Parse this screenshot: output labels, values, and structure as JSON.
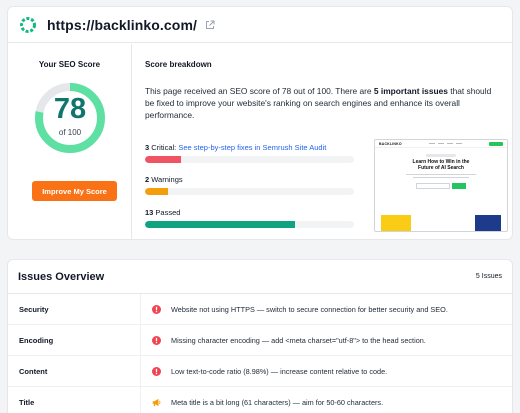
{
  "header": {
    "url": "https://backlinko.com/",
    "logo_icon": "semrush-ring-icon",
    "external_icon": "external-link-icon"
  },
  "score": {
    "title": "Your SEO Score",
    "value": "78",
    "out_of": "of 100",
    "fraction": 0.78,
    "ring_color": "#5ee0a3",
    "button_label": "Improve My Score"
  },
  "breakdown": {
    "title": "Score breakdown",
    "summary_before": "This page received an SEO score of 78 out of 100. There are ",
    "summary_bold": "5 important issues",
    "summary_after": " that should be fixed to improve your website's ranking on search engines and enhance its overall performance.",
    "metrics": [
      {
        "count": "3",
        "label": " Critical: ",
        "link": "See step-by-step fixes in Semrush Site Audit",
        "fill": 0.17,
        "color": "#ef5364"
      },
      {
        "count": "2",
        "label": " Warnings",
        "link": "",
        "fill": 0.11,
        "color": "#f59e0b"
      },
      {
        "count": "13",
        "label": " Passed",
        "link": "",
        "fill": 0.72,
        "color": "#10a37f"
      }
    ],
    "preview": {
      "logo": "BACKLINKO",
      "headline_line1": "Learn How to Win in the",
      "headline_line2": "Future of AI Search"
    }
  },
  "issues": {
    "title": "Issues Overview",
    "count": "5 Issues",
    "rows": [
      {
        "category": "Security",
        "icon": "critical-icon",
        "severity": "critical",
        "text": "Website not using HTTPS — switch to secure connection for better security and SEO."
      },
      {
        "category": "Encoding",
        "icon": "critical-icon",
        "severity": "critical",
        "text": "Missing character encoding — add <meta charset=\"utf-8\"> to the head section."
      },
      {
        "category": "Content",
        "icon": "critical-icon",
        "severity": "critical",
        "text": "Low text-to-code ratio (8.98%) — increase content relative to code."
      },
      {
        "category": "Title",
        "icon": "megaphone-icon",
        "severity": "warning",
        "text": "Meta title is a bit long (61 characters) — aim for 50-60 characters."
      }
    ]
  },
  "colors": {
    "critical": "#ef4452",
    "warning": "#f59e0b",
    "link": "#2563eb",
    "button": "#f97316"
  }
}
